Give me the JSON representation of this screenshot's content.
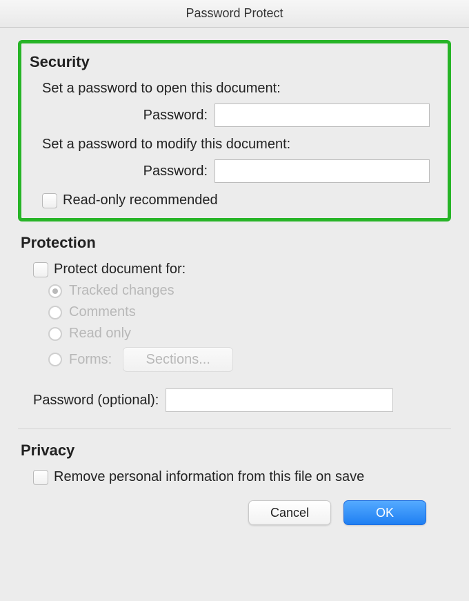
{
  "title": "Password Protect",
  "security": {
    "heading": "Security",
    "open_label": "Set a password to open this document:",
    "pw_label": "Password:",
    "pw_open_value": "",
    "modify_label": "Set a password to modify this document:",
    "pw_modify_value": "",
    "readonly_label": "Read-only recommended",
    "readonly_checked": false
  },
  "protection": {
    "heading": "Protection",
    "for_label": "Protect document for:",
    "for_checked": false,
    "options": {
      "tracked": "Tracked changes",
      "comments": "Comments",
      "readonly": "Read only",
      "forms": "Forms:"
    },
    "selected_option": "tracked",
    "sections_btn": "Sections...",
    "pw_label": "Password (optional):",
    "pw_value": ""
  },
  "privacy": {
    "heading": "Privacy",
    "remove_label": "Remove personal information from this file on save",
    "remove_checked": false
  },
  "buttons": {
    "cancel": "Cancel",
    "ok": "OK"
  }
}
